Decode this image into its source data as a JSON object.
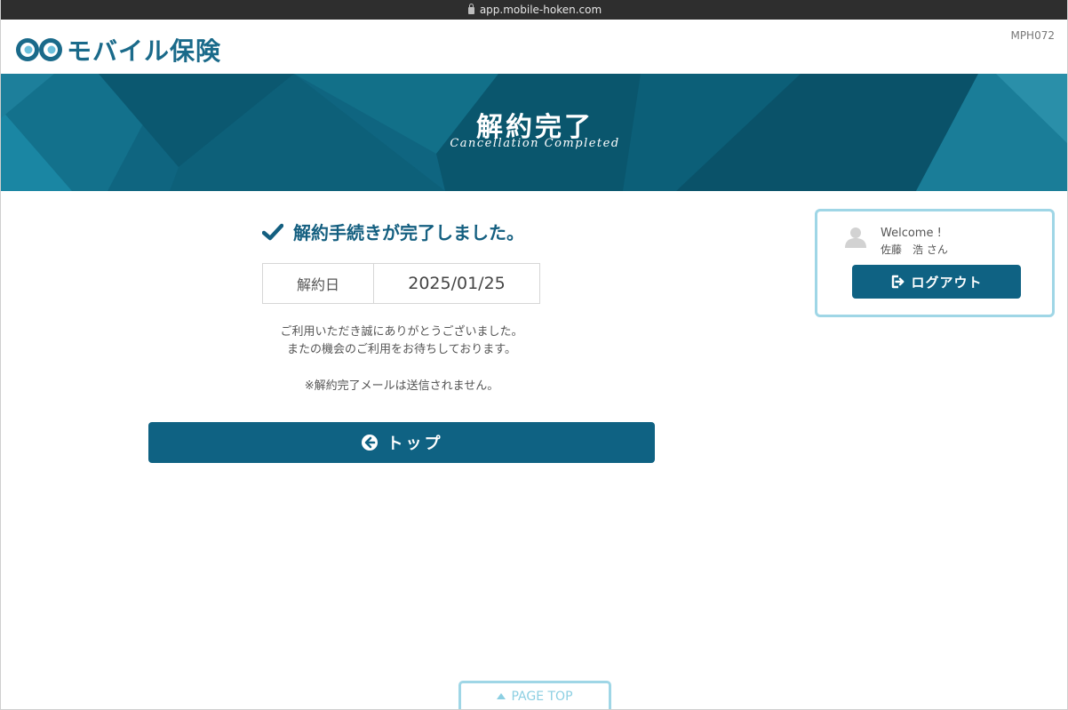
{
  "browser": {
    "url": "app.mobile-hoken.com"
  },
  "header": {
    "logo_text": "モバイル保険",
    "screen_code": "MPH072"
  },
  "banner": {
    "title": "解約完了",
    "subtitle": "Cancellation Completed"
  },
  "main": {
    "done_message": "解約手続きが完了しました。",
    "date_label": "解約日",
    "date_value": "2025/01/25",
    "note_line1": "ご利用いただき誠にありがとうございました。",
    "note_line2": "またの機会のご利用をお待ちしております。",
    "note_line3": "※解約完了メールは送信されません。",
    "top_button_label": "トップ"
  },
  "side": {
    "welcome": "Welcome !",
    "username": "佐藤　浩 さん",
    "logout_label": "ログアウト"
  },
  "footer": {
    "page_top_label": "PAGE TOP"
  },
  "colors": {
    "primary": "#0f6283",
    "accent_border": "#9fd6e6",
    "banner": "#0f6580",
    "logo": "#1a6a8a"
  },
  "icons": [
    "lock-icon",
    "logo-mark-icon",
    "check-icon",
    "arrow-left-circle-icon",
    "user-avatar-icon",
    "logout-icon",
    "triangle-up-icon"
  ]
}
